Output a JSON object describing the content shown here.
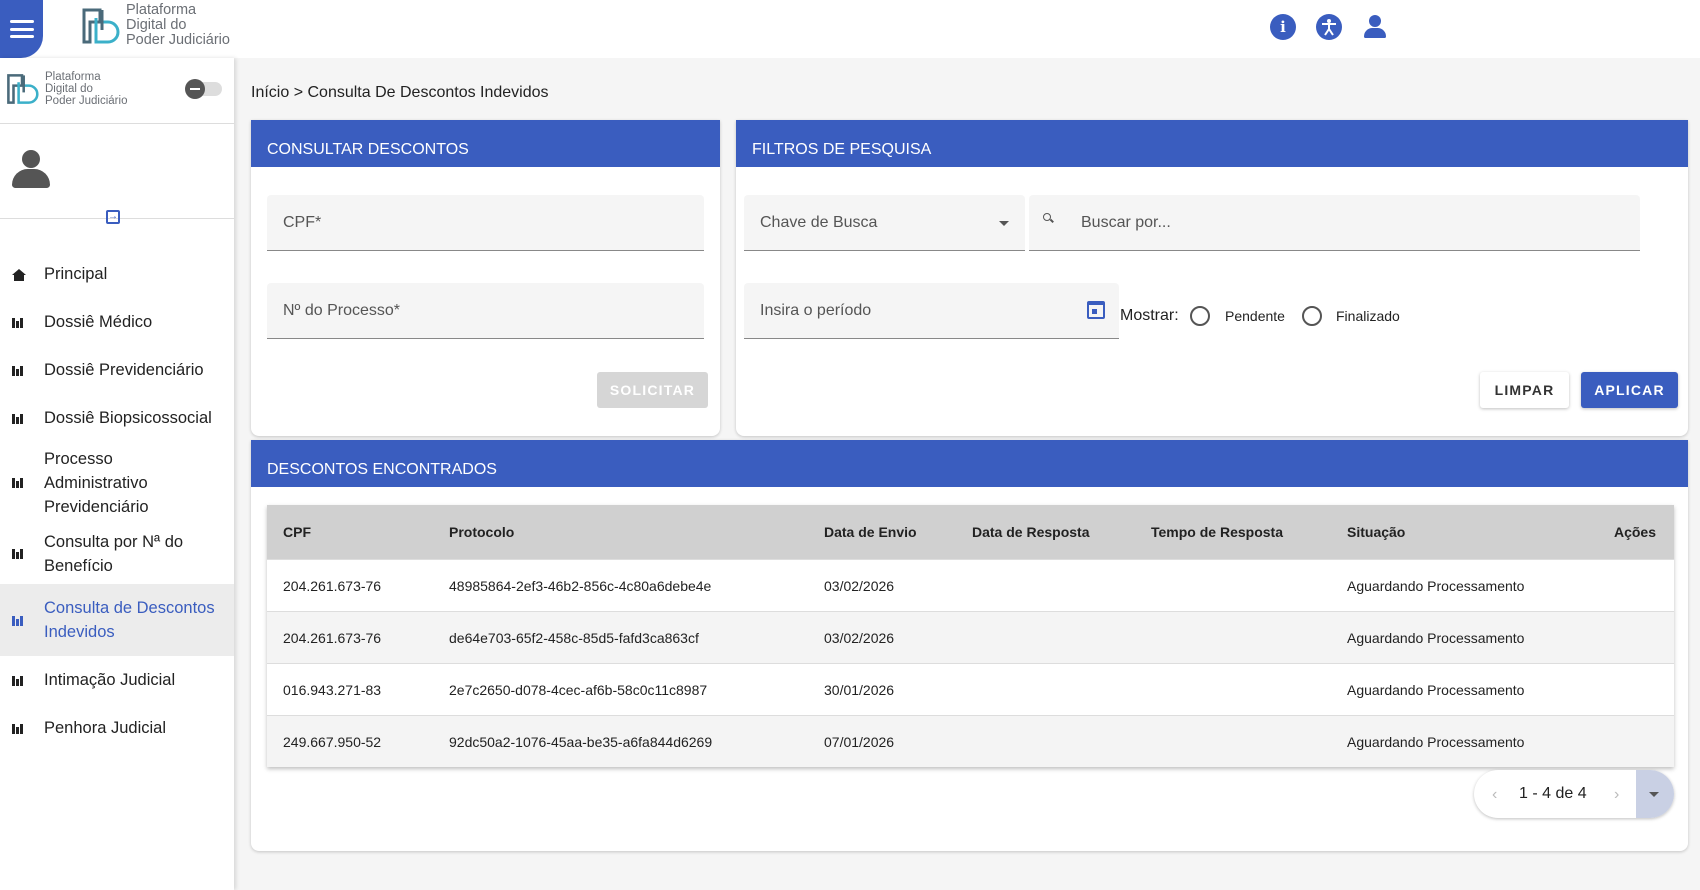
{
  "header": {
    "logo_lines": [
      "Plataforma",
      "Digital do",
      "Poder Judiciário"
    ],
    "icons": [
      "info-icon",
      "accessibility-icon",
      "user-icon"
    ]
  },
  "sidebar": {
    "logo_lines": [
      "Plataforma",
      "Digital do",
      "Poder Judiciário"
    ],
    "items": [
      {
        "label": "Principal",
        "icon": "home-icon"
      },
      {
        "label": "Dossiê Médico",
        "icon": "bars-icon"
      },
      {
        "label": "Dossiê Previdenciário",
        "icon": "bars-icon"
      },
      {
        "label": "Dossiê Biopsicossocial",
        "icon": "bars-icon"
      },
      {
        "label": "Processo Administrativo Previdenciário",
        "icon": "bars-icon"
      },
      {
        "label": "Consulta por Nª do Benefício",
        "icon": "bars-icon"
      },
      {
        "label": "Consulta de Descontos Indevidos",
        "icon": "bars-icon",
        "active": true
      },
      {
        "label": "Intimação Judicial",
        "icon": "bars-icon"
      },
      {
        "label": "Penhora Judicial",
        "icon": "bars-icon"
      }
    ]
  },
  "breadcrumb": {
    "home": "Início",
    "separator": ">",
    "current": "Consulta De Descontos Indevidos"
  },
  "consultar": {
    "title": "CONSULTAR DESCONTOS",
    "cpf_placeholder": "CPF*",
    "processo_placeholder": "Nº do Processo*",
    "solicitar_label": "SOLICITAR"
  },
  "filtros": {
    "title": "FILTROS DE PESQUISA",
    "chave_label": "Chave de Busca",
    "buscar_placeholder": "Buscar por...",
    "periodo_placeholder": "Insira o período",
    "mostrar_label": "Mostrar:",
    "radio_pendente": "Pendente",
    "radio_finalizado": "Finalizado",
    "limpar_label": "LIMPAR",
    "aplicar_label": "APLICAR"
  },
  "resultados": {
    "title": "DESCONTOS ENCONTRADOS",
    "columns": [
      "CPF",
      "Protocolo",
      "Data de Envio",
      "Data de Resposta",
      "Tempo de Resposta",
      "Situação",
      "Ações"
    ],
    "rows": [
      {
        "cpf": "204.261.673-76",
        "protocolo": "48985864-2ef3-46b2-856c-4c80a6debe4e",
        "envio": "03/02/2026",
        "resposta": "",
        "tempo": "",
        "situacao": "Aguardando Processamento"
      },
      {
        "cpf": "204.261.673-76",
        "protocolo": "de64e703-65f2-458c-85d5-fafd3ca863cf",
        "envio": "03/02/2026",
        "resposta": "",
        "tempo": "",
        "situacao": "Aguardando Processamento"
      },
      {
        "cpf": "016.943.271-83",
        "protocolo": "2e7c2650-d078-4cec-af6b-58c0c11c8987",
        "envio": "30/01/2026",
        "resposta": "",
        "tempo": "",
        "situacao": "Aguardando Processamento"
      },
      {
        "cpf": "249.667.950-52",
        "protocolo": "92dc50a2-1076-45aa-be35-a6fa844d6269",
        "envio": "07/01/2026",
        "resposta": "",
        "tempo": "",
        "situacao": "Aguardando Processamento"
      }
    ],
    "pagination": "1 - 4 de 4"
  },
  "colors": {
    "primary": "#3a5dbf",
    "sidebar_active_bg": "#ececec"
  }
}
